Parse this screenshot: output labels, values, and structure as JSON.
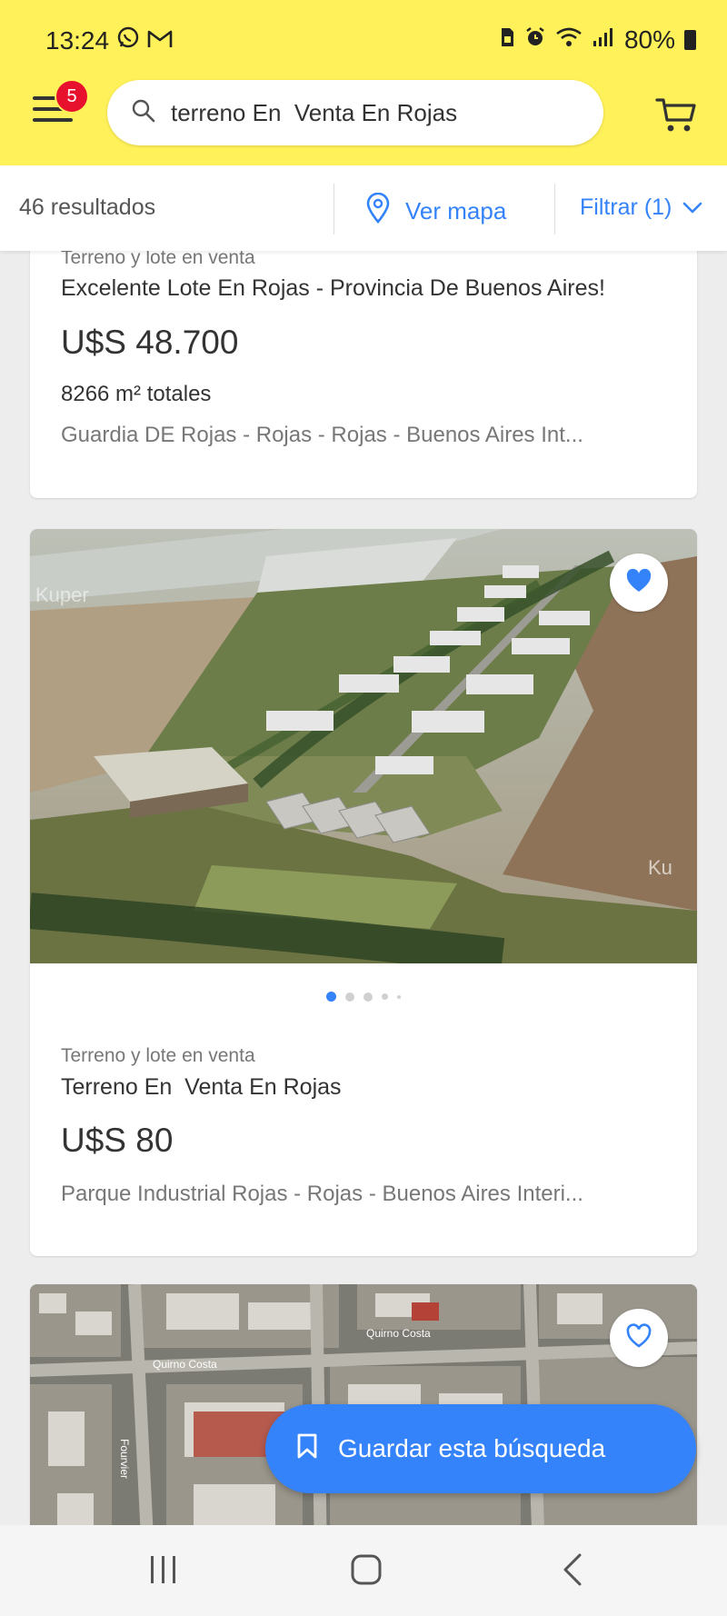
{
  "status_bar": {
    "time": "13:24",
    "battery": "80%",
    "left_icons": [
      "whatsapp-icon",
      "gmail-icon"
    ],
    "right_icons": [
      "sim-icon",
      "alarm-icon",
      "wifi-icon",
      "signal-icon",
      "battery-icon"
    ]
  },
  "header": {
    "menu_badge": "5",
    "search_query": "terreno En  Venta En Rojas",
    "brand_color": "#fff159",
    "accent_color": "#3483fa"
  },
  "results_bar": {
    "count_label": "46 resultados",
    "map_label": "Ver mapa",
    "filter_label": "Filtrar (1)"
  },
  "listings": [
    {
      "category": "Terreno y lote en venta",
      "title": "Excelente Lote En Rojas - Provincia De Buenos Aires!",
      "price": "U$S 48.700",
      "area": "8266 m² totales",
      "location": "Guardia DE Rojas - Rojas - Rojas - Buenos Aires Int..."
    },
    {
      "category": "Terreno y lote en venta",
      "title": "Terreno En  Venta En Rojas",
      "price": "U$S 80",
      "location": "Parque Industrial Rojas - Rojas - Buenos Aires Interi...",
      "favorited": true,
      "image_watermark_left": "Kuper",
      "image_watermark_right": "Ku",
      "carousel_dots": 5,
      "carousel_active": 0
    },
    {
      "favorited": false,
      "map_labels": [
        "Quirno Costa",
        "Quirno Costa",
        "Fourvier"
      ]
    }
  ],
  "save_search": {
    "label": "Guardar esta búsqueda"
  },
  "nav_bar": {
    "icons": [
      "recent-apps-icon",
      "home-icon",
      "back-icon"
    ]
  }
}
